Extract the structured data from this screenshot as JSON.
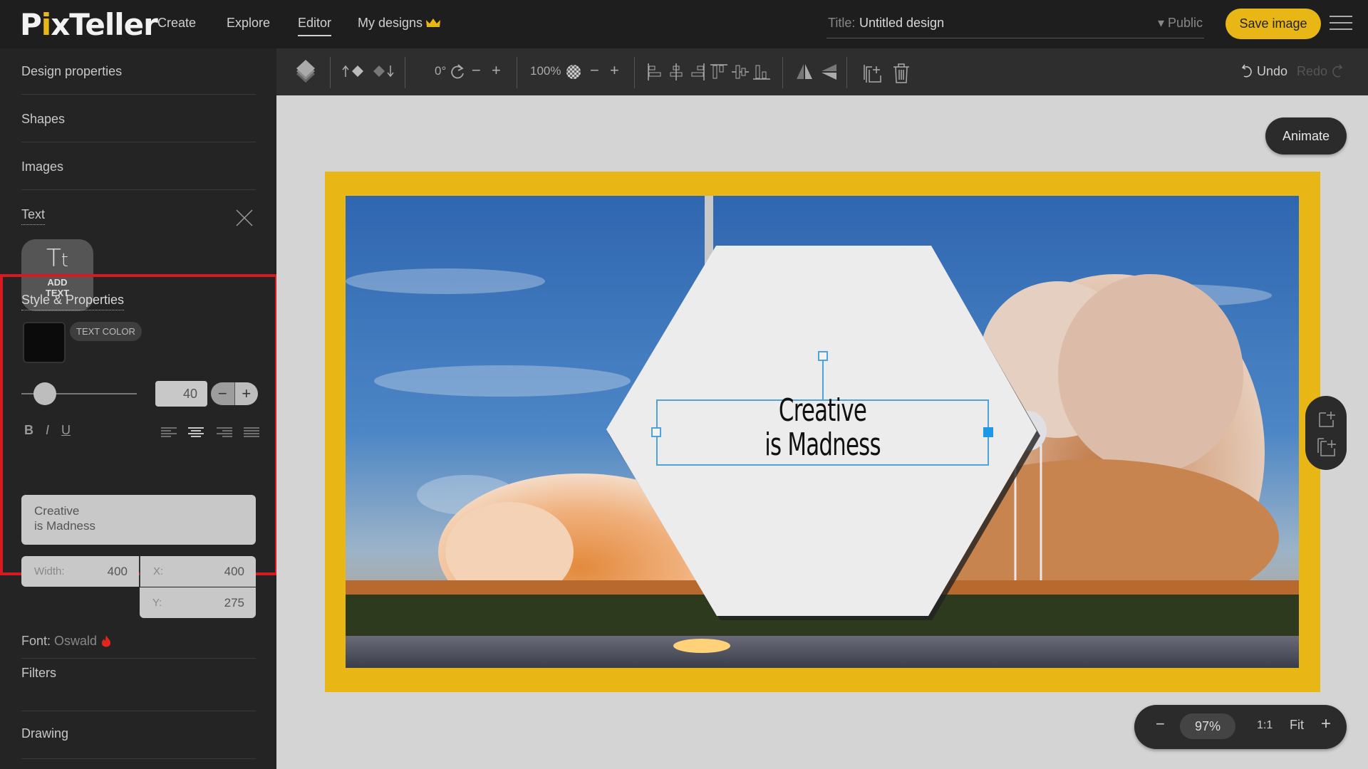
{
  "app": {
    "logo": "PixTeller",
    "nav": [
      {
        "label": "Create",
        "active": false
      },
      {
        "label": "Explore",
        "active": false
      },
      {
        "label": "Editor",
        "active": true
      },
      {
        "label": "My designs",
        "active": false,
        "icon": "crown-icon"
      }
    ],
    "title_label": "Title:",
    "title_value": "Untitled design",
    "visibility": "▾ Public",
    "save_label": "Save image",
    "accent": "#e8b715"
  },
  "sidebar": {
    "items": [
      {
        "label": "Design properties"
      },
      {
        "label": "Shapes"
      },
      {
        "label": "Images"
      },
      {
        "label": "Text"
      }
    ],
    "add_text": {
      "line1": "ADD",
      "line2": "TEXT"
    },
    "style": {
      "title": "Style & Properties",
      "text_color_label": "TEXT COLOR",
      "text_color": "#0b0b0b",
      "font_size": "40",
      "font_size_slider_fraction": 0.12,
      "text_value": "Creative\nis Madness",
      "width_label": "Width:",
      "width_value": "400",
      "x_label": "X:",
      "x_value": "400",
      "y_label": "Y:",
      "y_value": "275",
      "bold": "B",
      "italic": "I",
      "underline": "U",
      "alignment": "center"
    },
    "font_label": "Font:",
    "font_value": "Oswald",
    "filters_label": "Filters",
    "drawing_label": "Drawing"
  },
  "toolbar": {
    "rotation": "0°",
    "opacity": "100%",
    "undo_label": "Undo",
    "redo_label": "Redo"
  },
  "canvas": {
    "animate_label": "Animate",
    "design_text_line1": "Creative",
    "design_text_line2": "is Madness",
    "frame_color": "#e8b715",
    "selection_color": "#4fa3d8"
  },
  "zoom": {
    "value": "97%",
    "one_to_one": "1:1",
    "fit": "Fit"
  }
}
